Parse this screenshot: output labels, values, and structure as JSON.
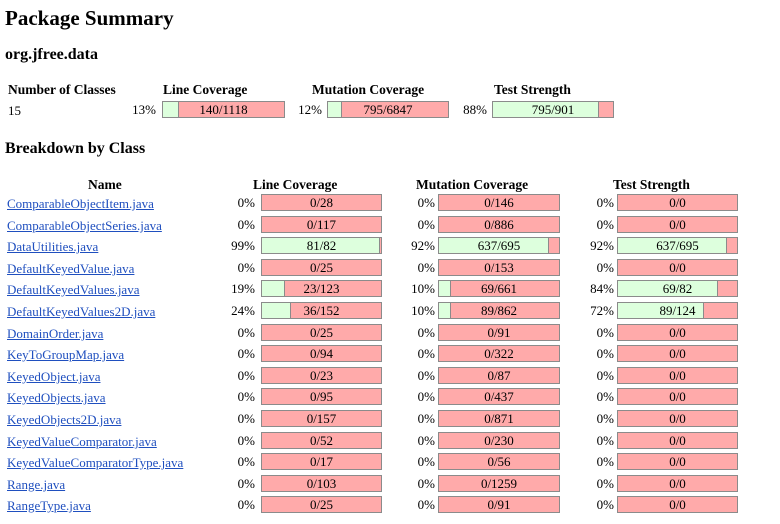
{
  "page": {
    "title": "Package Summary",
    "package_name": "org.jfree.data"
  },
  "summary": {
    "headers": {
      "classes": "Number of Classes",
      "line": "Line Coverage",
      "mutation": "Mutation Coverage",
      "strength": "Test Strength"
    },
    "classes_count": "15",
    "line": {
      "pct": "13%",
      "label": "140/1118",
      "fraction": 0.13
    },
    "mutation": {
      "pct": "12%",
      "label": "795/6847",
      "fraction": 0.12
    },
    "strength": {
      "pct": "88%",
      "label": "795/901",
      "fraction": 0.88
    }
  },
  "breakdown": {
    "title": "Breakdown by Class",
    "headers": {
      "name": "Name",
      "line": "Line Coverage",
      "mutation": "Mutation Coverage",
      "strength": "Test Strength"
    },
    "rows": [
      {
        "name": "ComparableObjectItem.java",
        "line_pct": "0%",
        "line": "0/28",
        "line_frac": 0,
        "mut_pct": "0%",
        "mut": "0/146",
        "mut_frac": 0,
        "str_pct": "0%",
        "str": "0/0",
        "str_frac": 0
      },
      {
        "name": "ComparableObjectSeries.java",
        "line_pct": "0%",
        "line": "0/117",
        "line_frac": 0,
        "mut_pct": "0%",
        "mut": "0/886",
        "mut_frac": 0,
        "str_pct": "0%",
        "str": "0/0",
        "str_frac": 0
      },
      {
        "name": "DataUtilities.java",
        "line_pct": "99%",
        "line": "81/82",
        "line_frac": 0.99,
        "mut_pct": "92%",
        "mut": "637/695",
        "mut_frac": 0.92,
        "str_pct": "92%",
        "str": "637/695",
        "str_frac": 0.92
      },
      {
        "name": "DefaultKeyedValue.java",
        "line_pct": "0%",
        "line": "0/25",
        "line_frac": 0,
        "mut_pct": "0%",
        "mut": "0/153",
        "mut_frac": 0,
        "str_pct": "0%",
        "str": "0/0",
        "str_frac": 0
      },
      {
        "name": "DefaultKeyedValues.java",
        "line_pct": "19%",
        "line": "23/123",
        "line_frac": 0.19,
        "mut_pct": "10%",
        "mut": "69/661",
        "mut_frac": 0.1,
        "str_pct": "84%",
        "str": "69/82",
        "str_frac": 0.84
      },
      {
        "name": "DefaultKeyedValues2D.java",
        "line_pct": "24%",
        "line": "36/152",
        "line_frac": 0.24,
        "mut_pct": "10%",
        "mut": "89/862",
        "mut_frac": 0.1,
        "str_pct": "72%",
        "str": "89/124",
        "str_frac": 0.72
      },
      {
        "name": "DomainOrder.java",
        "line_pct": "0%",
        "line": "0/25",
        "line_frac": 0,
        "mut_pct": "0%",
        "mut": "0/91",
        "mut_frac": 0,
        "str_pct": "0%",
        "str": "0/0",
        "str_frac": 0
      },
      {
        "name": "KeyToGroupMap.java",
        "line_pct": "0%",
        "line": "0/94",
        "line_frac": 0,
        "mut_pct": "0%",
        "mut": "0/322",
        "mut_frac": 0,
        "str_pct": "0%",
        "str": "0/0",
        "str_frac": 0
      },
      {
        "name": "KeyedObject.java",
        "line_pct": "0%",
        "line": "0/23",
        "line_frac": 0,
        "mut_pct": "0%",
        "mut": "0/87",
        "mut_frac": 0,
        "str_pct": "0%",
        "str": "0/0",
        "str_frac": 0
      },
      {
        "name": "KeyedObjects.java",
        "line_pct": "0%",
        "line": "0/95",
        "line_frac": 0,
        "mut_pct": "0%",
        "mut": "0/437",
        "mut_frac": 0,
        "str_pct": "0%",
        "str": "0/0",
        "str_frac": 0
      },
      {
        "name": "KeyedObjects2D.java",
        "line_pct": "0%",
        "line": "0/157",
        "line_frac": 0,
        "mut_pct": "0%",
        "mut": "0/871",
        "mut_frac": 0,
        "str_pct": "0%",
        "str": "0/0",
        "str_frac": 0
      },
      {
        "name": "KeyedValueComparator.java",
        "line_pct": "0%",
        "line": "0/52",
        "line_frac": 0,
        "mut_pct": "0%",
        "mut": "0/230",
        "mut_frac": 0,
        "str_pct": "0%",
        "str": "0/0",
        "str_frac": 0
      },
      {
        "name": "KeyedValueComparatorType.java",
        "line_pct": "0%",
        "line": "0/17",
        "line_frac": 0,
        "mut_pct": "0%",
        "mut": "0/56",
        "mut_frac": 0,
        "str_pct": "0%",
        "str": "0/0",
        "str_frac": 0
      },
      {
        "name": "Range.java",
        "line_pct": "0%",
        "line": "0/103",
        "line_frac": 0,
        "mut_pct": "0%",
        "mut": "0/1259",
        "mut_frac": 0,
        "str_pct": "0%",
        "str": "0/0",
        "str_frac": 0
      },
      {
        "name": "RangeType.java",
        "line_pct": "0%",
        "line": "0/25",
        "line_frac": 0,
        "mut_pct": "0%",
        "mut": "0/91",
        "mut_frac": 0,
        "str_pct": "0%",
        "str": "0/0",
        "str_frac": 0
      }
    ]
  },
  "colors": {
    "covered": "#ddffdd",
    "uncovered": "#ffaaaa",
    "link": "#1f4fbf"
  }
}
